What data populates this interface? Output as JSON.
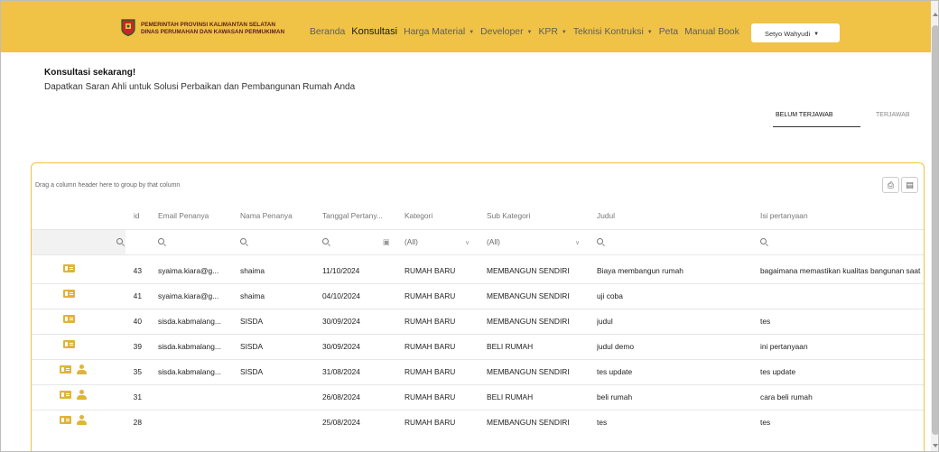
{
  "header": {
    "brand_line1": "PEMERINTAH PROVINSI KALIMANTAN SELATAN",
    "brand_line2": "DINAS PERUMAHAN DAN KAWASAN PERMUKIMAN",
    "menu": [
      {
        "label": "Beranda",
        "active": false,
        "dropdown": false
      },
      {
        "label": "Konsultasi",
        "active": true,
        "dropdown": false
      },
      {
        "label": "Harga Material",
        "active": false,
        "dropdown": true
      },
      {
        "label": "Developer",
        "active": false,
        "dropdown": true
      },
      {
        "label": "KPR",
        "active": false,
        "dropdown": true
      },
      {
        "label": "Teknisi Kontruksi",
        "active": false,
        "dropdown": true
      },
      {
        "label": "Peta",
        "active": false,
        "dropdown": false
      },
      {
        "label": "Manual Book",
        "active": false,
        "dropdown": false
      }
    ],
    "user": "Setyo Wahyudi"
  },
  "page": {
    "title": "Konsultasi sekarang!",
    "subtitle": "Dapatkan Saran Ahli untuk Solusi Perbaikan dan Pembangunan Rumah Anda"
  },
  "tabs": [
    "BELUM TERJAWAB",
    "TERJAWAB"
  ],
  "grid": {
    "group_hint": "Drag a column header here to group by that column",
    "columns": [
      "id",
      "Email Penanya",
      "Nama Penanya",
      "Tanggal Pertany...",
      "Kategori",
      "Sub Kategori",
      "Judul",
      "Isi pertanyaan"
    ],
    "filter_kategori": "(All)",
    "filter_subkategori": "(All)",
    "rows": [
      {
        "id": "43",
        "email": "syaima.kiara@g...",
        "nama": "shaima",
        "tanggal": "11/10/2024",
        "kategori": "RUMAH BARU",
        "sub": "MEMBANGUN SENDIRI",
        "judul": "Biaya membangun rumah",
        "isi": "bagaimana memastikan kualitas bangunan saat",
        "person": false
      },
      {
        "id": "41",
        "email": "syaima.kiara@g...",
        "nama": "shaima",
        "tanggal": "04/10/2024",
        "kategori": "RUMAH BARU",
        "sub": "MEMBANGUN SENDIRI",
        "judul": "uji coba",
        "isi": "",
        "person": false
      },
      {
        "id": "40",
        "email": "sisda.kabmalang...",
        "nama": "SISDA",
        "tanggal": "30/09/2024",
        "kategori": "RUMAH BARU",
        "sub": "MEMBANGUN SENDIRI",
        "judul": "judul",
        "isi": "tes",
        "person": false
      },
      {
        "id": "39",
        "email": "sisda.kabmalang...",
        "nama": "SISDA",
        "tanggal": "30/09/2024",
        "kategori": "RUMAH BARU",
        "sub": "BELI RUMAH",
        "judul": "judul demo",
        "isi": "ini pertanyaan",
        "person": false
      },
      {
        "id": "35",
        "email": "sisda.kabmalang...",
        "nama": "SISDA",
        "tanggal": "31/08/2024",
        "kategori": "RUMAH BARU",
        "sub": "MEMBANGUN SENDIRI",
        "judul": "tes update",
        "isi": "tes update",
        "person": true
      },
      {
        "id": "31",
        "email": "",
        "nama": "",
        "tanggal": "26/08/2024",
        "kategori": "RUMAH BARU",
        "sub": "BELI RUMAH",
        "judul": "beli rumah",
        "isi": "cara beli rumah",
        "person": true
      },
      {
        "id": "28",
        "email": "",
        "nama": "",
        "tanggal": "25/08/2024",
        "kategori": "RUMAH BARU",
        "sub": "MEMBANGUN SENDIRI",
        "judul": "tes",
        "isi": "tes",
        "person": true
      }
    ]
  }
}
